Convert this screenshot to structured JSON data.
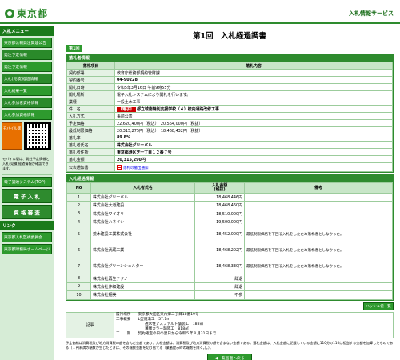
{
  "header": {
    "logo_text": "東京都",
    "service_name": "入札情報サービス"
  },
  "sidebar": {
    "menu_title": "入札メニュー",
    "items": [
      "東京都公報発注関連公告",
      "発注予定情報",
      "発注予定情報",
      "入札(見積)経過情報",
      "入札結果一覧",
      "入札参加者資格情報",
      "入札参加資格情報"
    ],
    "mobile_label": "モバイル版",
    "mobile_note": "モバイル版は、発注予定情報と入札(見積)経過情報が確認できます。",
    "links": [
      "電子調達システム(TOP)",
      "電 子 入 札",
      "資 格 審 査"
    ],
    "links_title": "リンク",
    "external_links": [
      "東京都入札監視委員会",
      "東京都財務局ホームページ"
    ]
  },
  "main": {
    "title": "第1回　入札経過調書",
    "round_tab": "第1回",
    "info": {
      "section_title": "落札者情報",
      "col_item": "落札項目",
      "col_content": "落札内容",
      "rows": [
        {
          "label": "契約部署",
          "value": "教育庁総務部契約管財課"
        },
        {
          "label": "契約番号",
          "value": "04-90228"
        },
        {
          "label": "開札日時",
          "value": "令和5年3月16日 午前9時55分"
        },
        {
          "label": "開札場所",
          "value": "電子入札システムにより開札を行います。"
        },
        {
          "label": "業種",
          "value": "一般土木工事"
        }
      ],
      "case_label": "件　名",
      "case_tag": "【電子】",
      "case_name": "都立城南特別支援学校（４）校内通路改修工事",
      "rows2": [
        {
          "label": "入札方式",
          "value": "事前公表"
        },
        {
          "label": "予定価格",
          "value": "22,620,400円（税込）　20,564,000円（税抜）"
        },
        {
          "label": "最低制限価格",
          "value": "20,315,275円（税込）　18,468,432円（税抜）"
        }
      ],
      "rate_label": "落札率",
      "rate_value": "89.8%",
      "winner_label": "落札者氏名",
      "winner_value": "株式会社グリーバル",
      "address_label": "落札者住所",
      "address_value": "東京都港区芝一丁目１２番７号",
      "amount_label": "落札金額",
      "amount_value": "20,315,290円",
      "doc_label": "公表通知書",
      "doc_link": "落札の撤出通知"
    },
    "bids": {
      "section_title": "入札経過情報",
      "headers": [
        "No",
        "入札者氏名",
        "入札金額\n(税抜)",
        "備考"
      ],
      "rows": [
        {
          "no": "1",
          "name": "株式会社グリーバル",
          "amount": "18,468,446円",
          "note": ""
        },
        {
          "no": "2",
          "name": "株式会社大道建設",
          "amount": "18,468,460円",
          "note": ""
        },
        {
          "no": "3",
          "name": "株式会社ワイオリ",
          "amount": "18,510,000円",
          "note": ""
        },
        {
          "no": "4",
          "name": "株式会社ハネイシ",
          "amount": "19,500,000円",
          "note": ""
        },
        {
          "no": "5",
          "name": "荒木建設工業株式会社",
          "amount": "18,452,000円",
          "note": "最低制限価格を下回る入札をしたため落札者としなかった。"
        },
        {
          "no": "6",
          "name": "株式会社武蔵工業",
          "amount": "18,468,202円",
          "note": "最低制限価格を下回る入札をしたため落札者としなかった。"
        },
        {
          "no": "7",
          "name": "株式会社グリーンシェルター",
          "amount": "18,468,330円",
          "note": "最低制限価格を下回る入札をしたため落札者としなかった。"
        },
        {
          "no": "8",
          "name": "株式会社再生テクノ",
          "amount": "辞退",
          "note": ""
        },
        {
          "no": "9",
          "name": "株式会社伸和建設",
          "amount": "辞退",
          "note": ""
        },
        {
          "no": "10",
          "name": "株式会社翔美",
          "amount": "不参",
          "note": ""
        }
      ]
    },
    "share_button": "ハッシュ値一覧",
    "remarks": {
      "label": "記事",
      "lines": [
        "履行場所　　東京都大田区東六郷二丁目18番19号",
        "工事概要　　L型側溝工　57.1m",
        "透水性アスファルト舗装工　188㎡",
        "薄層カラー舗装工　818㎡",
        "工　　期　　契約確定の日の翌日から令和５年８月31日まで"
      ]
    },
    "footnote": "予定価格は消費税及び地方消費税の額を含んだ金額であり、入札金額は、消費税及び地方消費税の額を含まない金額である。落札金額は、入札金額に記載している金額に110分の110に相当する金額を加算したものである（１円未満の端数が生じたときは、その端数金額を切り捨てる（業者提示時の端数を除く。）。）。",
    "back_button": "◀一覧画面へ戻る"
  }
}
